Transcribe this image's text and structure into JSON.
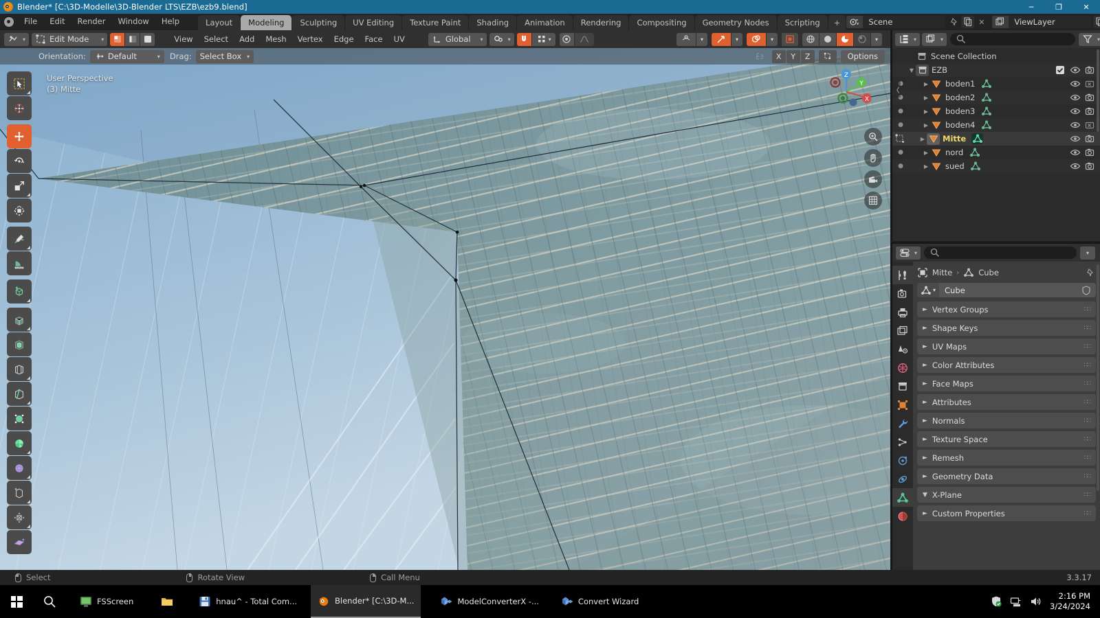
{
  "window": {
    "title": "Blender* [C:\\3D-Modelle\\3D-Blender LTS\\EZB\\ezb9.blend]",
    "minimize": "─",
    "maximize": "❐",
    "close": "✕"
  },
  "topbar": {
    "menus": [
      "File",
      "Edit",
      "Render",
      "Window",
      "Help"
    ],
    "tabs": [
      {
        "label": "Layout",
        "active": false
      },
      {
        "label": "Modeling",
        "active": true
      },
      {
        "label": "Sculpting",
        "active": false
      },
      {
        "label": "UV Editing",
        "active": false
      },
      {
        "label": "Texture Paint",
        "active": false
      },
      {
        "label": "Shading",
        "active": false
      },
      {
        "label": "Animation",
        "active": false
      },
      {
        "label": "Rendering",
        "active": false
      },
      {
        "label": "Compositing",
        "active": false
      },
      {
        "label": "Geometry Nodes",
        "active": false
      },
      {
        "label": "Scripting",
        "active": false
      }
    ],
    "add_workspace": "+",
    "scene_name": "Scene",
    "viewlayer_name": "ViewLayer"
  },
  "viewport_header": {
    "editor_type_caret": "⌄",
    "mode": "Edit Mode",
    "select_modes": [
      "vertex",
      "edge",
      "face"
    ],
    "select_mode_active": 0,
    "menus": [
      "View",
      "Select",
      "Add",
      "Mesh",
      "Vertex",
      "Edge",
      "Face",
      "UV"
    ],
    "transform_orientation": "Global",
    "snap_enabled": true,
    "proportional_edit": false,
    "shading_modes": [
      "wireframe",
      "solid",
      "material-preview",
      "rendered"
    ],
    "shading_active": 2
  },
  "tool_settings": {
    "orientation_label": "Orientation:",
    "orientation_value": "Default",
    "drag_label": "Drag:",
    "drag_value": "Select Box",
    "axis_buttons": [
      "X",
      "Y",
      "Z"
    ],
    "options_label": "Options"
  },
  "viewport": {
    "perspective_label": "User Perspective",
    "collection_label": "(3) Mitte",
    "gizmo_axes": [
      "X",
      "Y",
      "Z"
    ],
    "nav_buttons": [
      "zoom-icon",
      "pan-hand-icon",
      "camera-icon",
      "ortho-grid-icon"
    ]
  },
  "left_toolbar": [
    {
      "name": "tweak-tool",
      "icon": "cursor-select",
      "active": false
    },
    {
      "name": "cursor-tool",
      "icon": "3d-cursor",
      "active": false
    },
    {
      "name": "move-tool",
      "icon": "move-arrows",
      "active": true
    },
    {
      "name": "rotate-tool",
      "icon": "rotate-arrows",
      "active": false
    },
    {
      "name": "scale-tool",
      "icon": "scale-box",
      "active": false
    },
    {
      "name": "transform-tool",
      "icon": "transform-combo",
      "active": false
    },
    {
      "name": "annotate-tool",
      "icon": "pencil",
      "active": false
    },
    {
      "name": "measure-tool",
      "icon": "ruler",
      "active": false
    },
    {
      "name": "add-cube-tool",
      "icon": "add-cube",
      "active": false
    },
    {
      "name": "extrude-region-tool",
      "icon": "extrude-cube",
      "active": false
    },
    {
      "name": "inset-faces-tool",
      "icon": "inset-faces",
      "active": false
    },
    {
      "name": "bevel-tool",
      "icon": "bevel-cube",
      "active": false
    },
    {
      "name": "loop-cut-tool",
      "icon": "loop-cut",
      "active": false
    },
    {
      "name": "knife-tool",
      "icon": "knife",
      "active": false
    },
    {
      "name": "poly-build-tool",
      "icon": "poly-build",
      "active": false
    },
    {
      "name": "spin-tool",
      "icon": "spin",
      "active": false
    },
    {
      "name": "smooth-tool",
      "icon": "smooth-sphere",
      "active": false
    },
    {
      "name": "edge-slide-tool",
      "icon": "edge-slide",
      "active": false
    },
    {
      "name": "shrink-fatten-tool",
      "icon": "shrink-fatten",
      "active": false
    },
    {
      "name": "shear-tool",
      "icon": "shear",
      "active": false
    }
  ],
  "outliner": {
    "display_mode": "view-layer",
    "filter_icon": "filter-icon",
    "search_placeholder": "",
    "rows": [
      {
        "label": "Scene Collection",
        "icon": "collection-icon",
        "indent": 0,
        "type": "scene-collection",
        "expand": "",
        "selected": false,
        "checkbox": false,
        "eye": false,
        "camera": false
      },
      {
        "label": "EZB",
        "icon": "collection-icon",
        "indent": 1,
        "type": "collection",
        "expand": "▼",
        "selected": false,
        "checkbox": true,
        "eye": true,
        "camera": true
      },
      {
        "label": "boden1",
        "icon": "mesh-object-icon",
        "indent": 2,
        "type": "object",
        "expand": "▶",
        "selected": false,
        "eye": true,
        "camera": true,
        "mesh_highlight": false
      },
      {
        "label": "boden2",
        "icon": "mesh-object-icon",
        "indent": 2,
        "type": "object",
        "expand": "▶",
        "selected": false,
        "eye": true,
        "camera": true,
        "mesh_highlight": false
      },
      {
        "label": "boden3",
        "icon": "mesh-object-icon",
        "indent": 2,
        "type": "object",
        "expand": "▶",
        "selected": false,
        "eye": true,
        "camera": true,
        "mesh_highlight": false
      },
      {
        "label": "boden4",
        "icon": "mesh-object-icon",
        "indent": 2,
        "type": "object",
        "expand": "▶",
        "selected": false,
        "eye": true,
        "camera": true,
        "mesh_highlight": false
      },
      {
        "label": "Mitte",
        "icon": "mesh-object-icon",
        "indent": 2,
        "type": "object",
        "expand": "▶",
        "selected": true,
        "eye": true,
        "camera": true,
        "mesh_highlight": true
      },
      {
        "label": "nord",
        "icon": "mesh-object-icon",
        "indent": 2,
        "type": "object",
        "expand": "▶",
        "selected": false,
        "eye": true,
        "camera": true,
        "mesh_highlight": false
      },
      {
        "label": "sued",
        "icon": "mesh-object-icon",
        "indent": 2,
        "type": "object",
        "expand": "▶",
        "selected": false,
        "eye": true,
        "camera": true,
        "mesh_highlight": false
      }
    ]
  },
  "properties": {
    "search_placeholder": "",
    "breadcrumb_object": "Mitte",
    "breadcrumb_sep": "›",
    "breadcrumb_data": "Cube",
    "datablock_name": "Cube",
    "tabs": [
      {
        "name": "tool-tab",
        "icon": "tool-icon",
        "active": true,
        "color": "#c8c8c8"
      },
      {
        "name": "render-tab",
        "icon": "camera-back-icon",
        "active": false,
        "color": "#c8c8c8"
      },
      {
        "name": "output-tab",
        "icon": "printer-icon",
        "active": false,
        "color": "#c8c8c8"
      },
      {
        "name": "view-layer-tab",
        "icon": "images-icon",
        "active": false,
        "color": "#c8c8c8"
      },
      {
        "name": "scene-tab",
        "icon": "scene-cone-icon",
        "active": false,
        "color": "#c8c8c8"
      },
      {
        "name": "world-tab",
        "icon": "world-globe-icon",
        "active": false,
        "color": "#e06080"
      },
      {
        "name": "collection-tab",
        "icon": "collection-box-icon",
        "active": false,
        "color": "#c8c8c8"
      },
      {
        "name": "object-tab",
        "icon": "object-square-icon",
        "active": false,
        "color": "#e08030"
      },
      {
        "name": "modifier-tab",
        "icon": "wrench-icon",
        "active": false,
        "color": "#6a9fd8"
      },
      {
        "name": "particles-tab",
        "icon": "particles-icon",
        "active": false,
        "color": "#c8c8c8"
      },
      {
        "name": "physics-tab",
        "icon": "physics-orbit-icon",
        "active": false,
        "color": "#6a9fd8"
      },
      {
        "name": "constraints-tab",
        "icon": "constraints-icon",
        "active": false,
        "color": "#6a9fd8"
      },
      {
        "name": "object-data-tab",
        "icon": "mesh-data-triangle-icon",
        "active": true,
        "color": "#4fb98a"
      },
      {
        "name": "material-tab",
        "icon": "material-sphere-icon",
        "active": false,
        "color": "#d05050"
      }
    ],
    "panels": [
      {
        "label": "Vertex Groups",
        "expanded": false
      },
      {
        "label": "Shape Keys",
        "expanded": false
      },
      {
        "label": "UV Maps",
        "expanded": false
      },
      {
        "label": "Color Attributes",
        "expanded": false
      },
      {
        "label": "Face Maps",
        "expanded": false
      },
      {
        "label": "Attributes",
        "expanded": false
      },
      {
        "label": "Normals",
        "expanded": false
      },
      {
        "label": "Texture Space",
        "expanded": false
      },
      {
        "label": "Remesh",
        "expanded": false
      },
      {
        "label": "Geometry Data",
        "expanded": false
      },
      {
        "label": "X-Plane",
        "expanded": true
      },
      {
        "label": "Custom Properties",
        "expanded": false
      }
    ]
  },
  "statusbar": {
    "hints": [
      {
        "mouse": "left",
        "label": "Select"
      },
      {
        "mouse": "middle",
        "label": "Rotate View"
      },
      {
        "mouse": "right",
        "label": "Call Menu"
      }
    ],
    "version": "3.3.17"
  },
  "taskbar": {
    "start_icon": "windows-logo-icon",
    "search_icon": "search-icon",
    "items": [
      {
        "label": "",
        "icon": "folder-icon",
        "active": false,
        "name": "file-explorer"
      },
      {
        "label": "hnau^ - Total Com...",
        "icon": "floppy-icon",
        "active": false,
        "name": "total-commander"
      },
      {
        "label": "Blender* [C:\\3D-M...",
        "icon": "blender-icon",
        "active": true,
        "name": "blender"
      },
      {
        "label": "ModelConverterX -...",
        "icon": "app-blue-icon",
        "active": false,
        "name": "modelconverterx"
      },
      {
        "label": "Convert Wizard",
        "icon": "app-blue-icon",
        "active": false,
        "name": "convert-wizard"
      }
    ],
    "pinned_first": {
      "label": "FSScreen",
      "icon": "fsscreen-icon"
    },
    "tray": [
      "shield-icon",
      "network-icon",
      "volume-icon"
    ],
    "time": "2:16 PM",
    "date": "3/24/2024"
  },
  "colors": {
    "accent_orange": "#e06030",
    "title_blue": "#1b6a93",
    "selected_yellow": "#f0d86a",
    "mesh_green": "#4fb98a"
  }
}
